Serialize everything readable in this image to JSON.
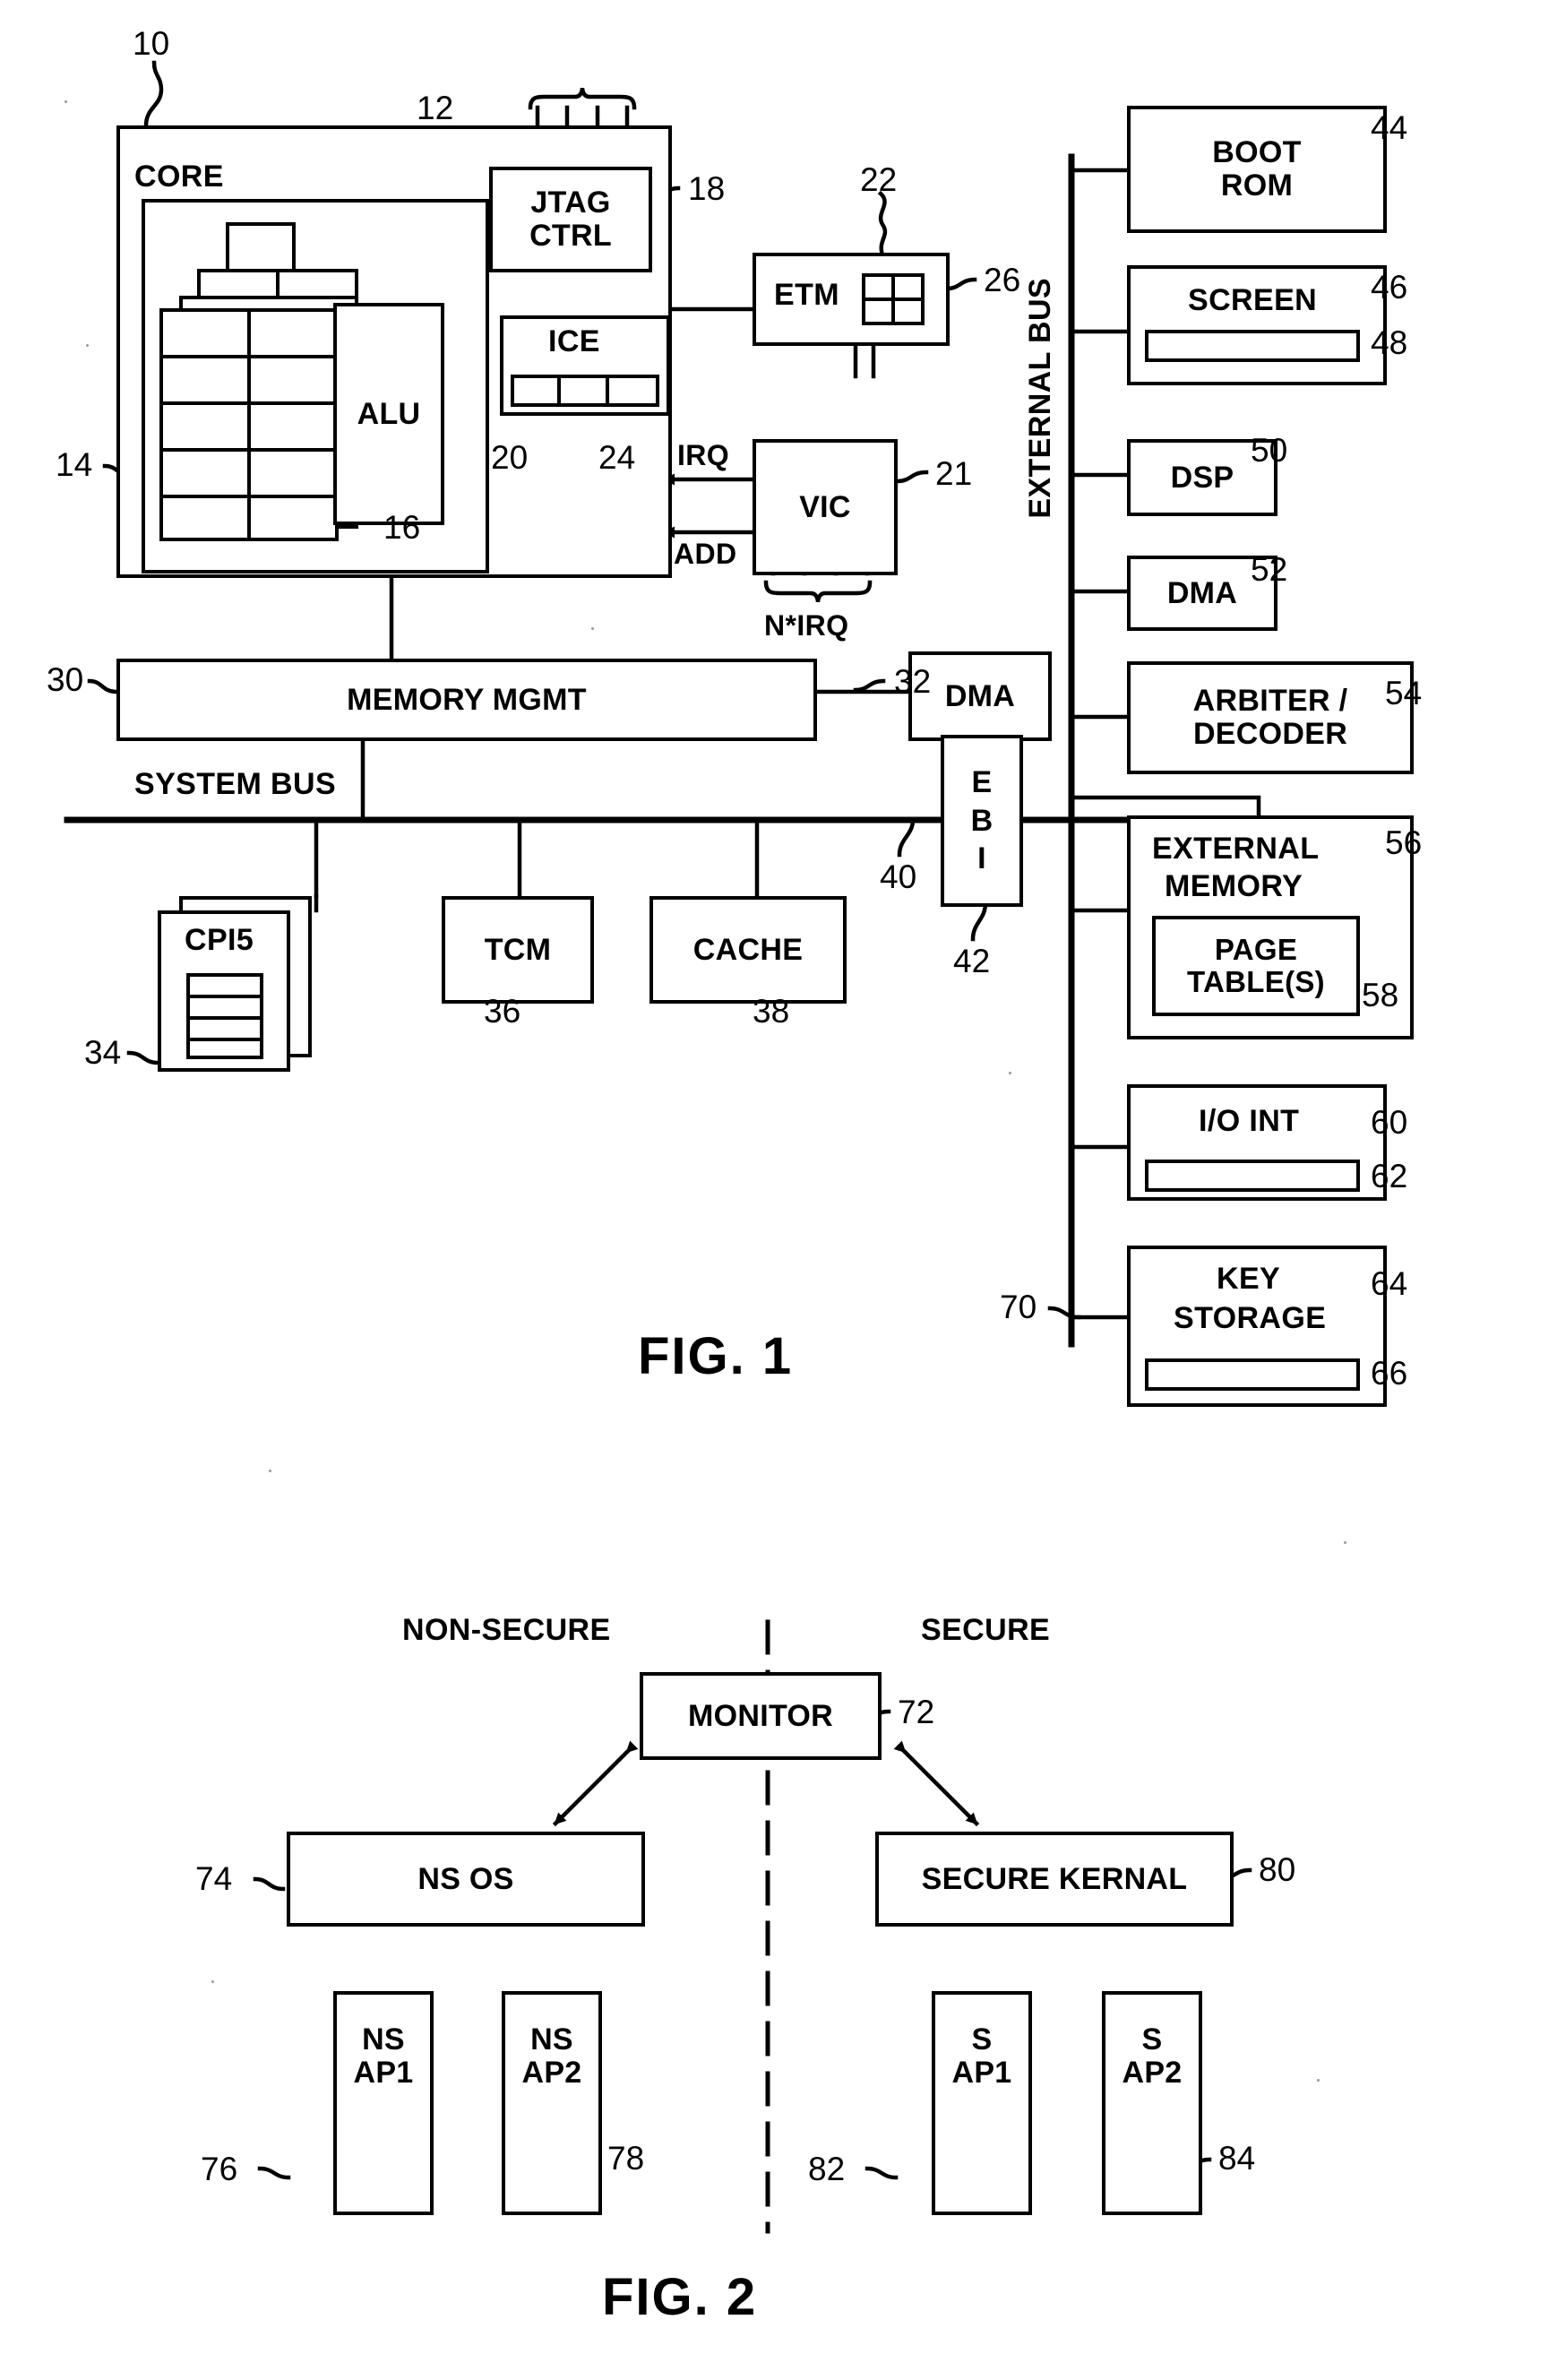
{
  "figure1": {
    "title": "FIG. 1",
    "core_label": "CORE",
    "system_bus_label": "SYSTEM BUS",
    "external_bus_label": "EXTERNAL BUS",
    "signals": {
      "irq": "IRQ",
      "add": "ADD",
      "n_irq": "N*IRQ"
    },
    "blocks": {
      "jtag_ctrl": "JTAG\nCTRL",
      "jtag_ctrl_line1": "JTAG",
      "jtag_ctrl_line2": "CTRL",
      "ice": "ICE",
      "alu": "ALU",
      "etm": "ETM",
      "vic": "VIC",
      "memory_mgmt": "MEMORY MGMT",
      "dma_core": "DMA",
      "ebi_line1": "E",
      "ebi_line2": "B",
      "ebi_line3": "I",
      "cp15": "CPI5",
      "tcm": "TCM",
      "cache": "CACHE",
      "boot_rom_line1": "BOOT",
      "boot_rom_line2": "ROM",
      "screen": "SCREEN",
      "dsp": "DSP",
      "dma_ext": "DMA",
      "arbiter_line1": "ARBITER /",
      "arbiter_line2": "DECODER",
      "ext_mem_line1": "EXTERNAL",
      "ext_mem_line2": "MEMORY",
      "page_tables_line1": "PAGE",
      "page_tables_line2": "TABLE(S)",
      "io_int": "I/O INT",
      "key_storage_line1": "KEY",
      "key_storage_line2": "STORAGE"
    },
    "numerals": {
      "n10": "10",
      "n12": "12",
      "n14": "14",
      "n16": "16",
      "n18": "18",
      "n20": "20",
      "n21": "21",
      "n22": "22",
      "n24": "24",
      "n26": "26",
      "n30": "30",
      "n32": "32",
      "n34": "34",
      "n36": "36",
      "n38": "38",
      "n40": "40",
      "n42": "42",
      "n44": "44",
      "n46": "46",
      "n48": "48",
      "n50": "50",
      "n52": "52",
      "n54": "54",
      "n56": "56",
      "n58": "58",
      "n60": "60",
      "n62": "62",
      "n64": "64",
      "n66": "66",
      "n70": "70"
    }
  },
  "figure2": {
    "title": "FIG. 2",
    "domain_left": "NON-SECURE",
    "domain_right": "SECURE",
    "blocks": {
      "monitor": "MONITOR",
      "ns_os": "NS OS",
      "secure_kernal": "SECURE KERNAL",
      "ns_ap1_line1": "NS",
      "ns_ap1_line2": "AP1",
      "ns_ap2_line1": "NS",
      "ns_ap2_line2": "AP2",
      "s_ap1_line1": "S",
      "s_ap1_line2": "AP1",
      "s_ap2_line1": "S",
      "s_ap2_line2": "AP2"
    },
    "numerals": {
      "n72": "72",
      "n74": "74",
      "n76": "76",
      "n78": "78",
      "n80": "80",
      "n82": "82",
      "n84": "84"
    }
  }
}
